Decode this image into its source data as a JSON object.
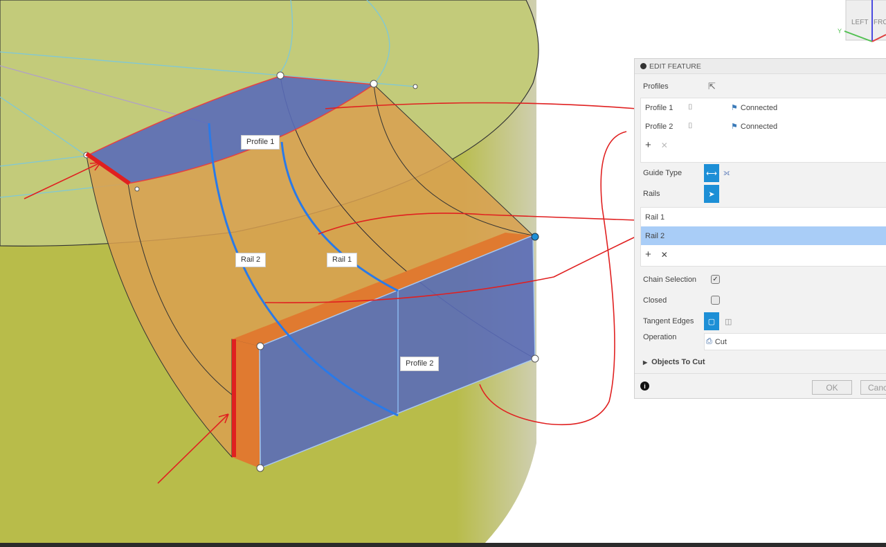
{
  "viewcube": {
    "face_left": "LEFT",
    "face_front": "FRONT",
    "axis_label": "Y"
  },
  "scene_labels": {
    "profile1": "Profile 1",
    "profile2": "Profile 2",
    "rail1": "Rail 1",
    "rail2": "Rail 2"
  },
  "panel": {
    "title": "EDIT FEATURE",
    "profiles_label": "Profiles",
    "profiles": [
      {
        "name": "Profile 1",
        "status": "Connected"
      },
      {
        "name": "Profile 2",
        "status": "Connected"
      }
    ],
    "guide_type_label": "Guide Type",
    "rails_label": "Rails",
    "rails": [
      {
        "name": "Rail 1",
        "selected": false
      },
      {
        "name": "Rail 2",
        "selected": true
      }
    ],
    "chain_selection_label": "Chain Selection",
    "chain_selection": true,
    "closed_label": "Closed",
    "closed": false,
    "tangent_edges_label": "Tangent Edges",
    "operation_label": "Operation",
    "operation_value": "Cut",
    "objects_to_cut_label": "Objects To Cut",
    "ok_label": "OK",
    "cancel_label": "Cancel"
  },
  "colors": {
    "accent": "#1d8fd6",
    "annotation": "#e02020",
    "profile_fill": "#5a6bb8",
    "body": "#d9a050",
    "top_face": "#c3cb7a",
    "side_face": "#b9bd4c"
  }
}
